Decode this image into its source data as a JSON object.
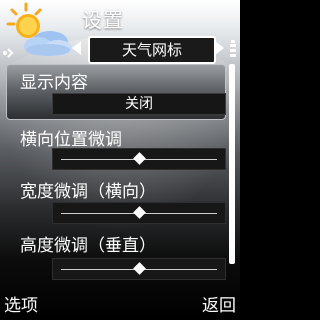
{
  "header": {
    "title": "设置"
  },
  "tab": {
    "label": "天气网标"
  },
  "list": {
    "display_content": {
      "label": "显示内容",
      "value": "关闭"
    },
    "horizontal_adjust": {
      "label": "横向位置微调",
      "level": 0.5
    },
    "width_adjust": {
      "label": "宽度微调（横向）",
      "level": 0.5
    },
    "height_adjust": {
      "label": "高度微调（垂直）",
      "level": 0.5
    }
  },
  "softkeys": {
    "left": "选项",
    "right": "返回"
  }
}
